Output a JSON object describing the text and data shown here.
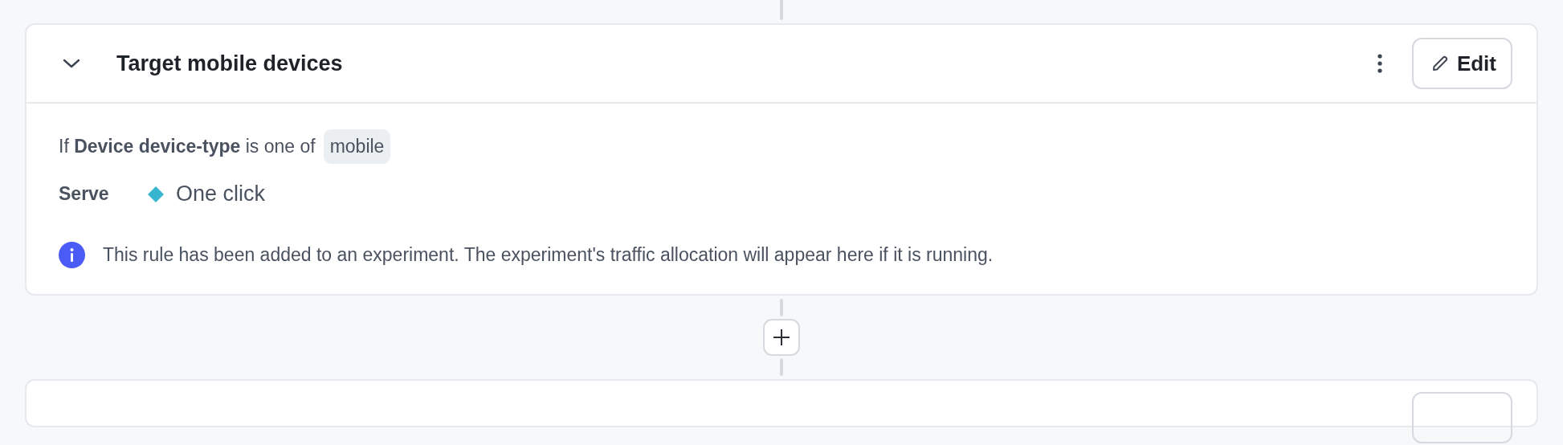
{
  "rule": {
    "title": "Target mobile devices",
    "expanded": true,
    "edit_label": "Edit",
    "condition": "If **Device device-type** is one of",
    "condition_values": [
      "mobile"
    ],
    "serve_label": "Serve",
    "variation": {
      "name": "One click",
      "color": "#38b6cf"
    },
    "info": "This rule has been added to an experiment. The experiment's traffic allocation will appear here if it is running."
  }
}
